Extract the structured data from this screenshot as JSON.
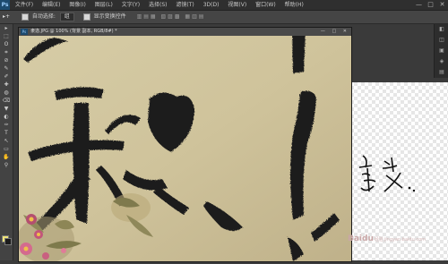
{
  "menubar": {
    "logo": "Ps",
    "items": [
      "文件(F)",
      "编辑(E)",
      "图像(I)",
      "图层(L)",
      "文字(Y)",
      "选择(S)",
      "滤镜(T)",
      "3D(D)",
      "视图(V)",
      "窗口(W)",
      "帮助(H)"
    ],
    "window_controls": [
      "—",
      "□",
      "✕"
    ]
  },
  "options_bar": {
    "tool": "▸+",
    "auto_select_label": "自动选择:",
    "auto_select_value": "组",
    "show_transform_label": "显示变换控件",
    "align_icons": "▥▤▦ ▧▨▩ ▦▥▤"
  },
  "toolbox": {
    "tools": [
      "▸",
      "⬚",
      "ʘ",
      "⌗",
      "⊘",
      "✎",
      "✐",
      "✚",
      "◍",
      "⌫",
      "▼",
      "◐",
      "✑",
      "T",
      "↖",
      "▭",
      "✋",
      "⚲"
    ]
  },
  "document": {
    "icon": "Ps",
    "title": "隶逸.JPG @ 100% (背景 副本, RGB/8#) *",
    "controls": "— □ ✕"
  },
  "right_strip": {
    "icons": [
      "◧",
      "◫",
      "▣",
      "◈",
      "▤"
    ]
  },
  "watermark": {
    "brand": "Baidu",
    "sub": "经验",
    "url": "jingyan.baidu.com"
  },
  "colors": {
    "foreground": "#efe47a",
    "background": "#1c1c1c",
    "paper": "#cfc39a",
    "ink": "#1e1e1e"
  }
}
